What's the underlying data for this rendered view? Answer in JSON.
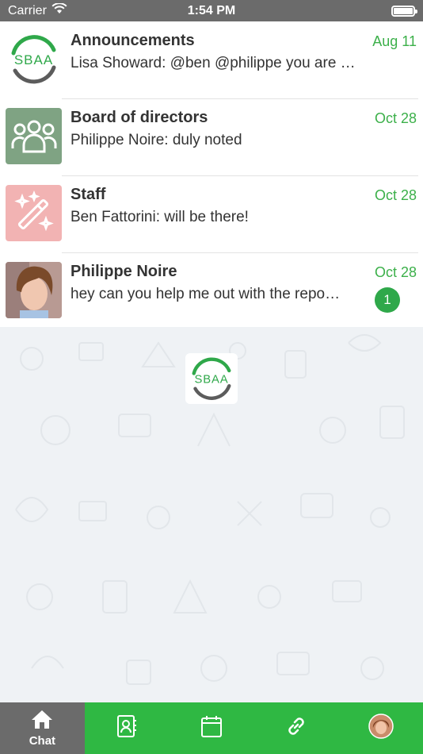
{
  "status_bar": {
    "carrier": "Carrier",
    "time": "1:54 PM",
    "battery_level": 1.0
  },
  "chats": [
    {
      "name": "Announcements",
      "preview": "Lisa Showard: @ben @philippe you are …",
      "date": "Aug 11",
      "avatar": "sbaa-logo",
      "unread": ""
    },
    {
      "name": "Board of directors",
      "preview": "Philippe Noire: duly noted",
      "date": "Oct 28",
      "avatar": "group-icon",
      "unread": ""
    },
    {
      "name": "Staff",
      "preview": "Ben Fattorini: will be there!",
      "date": "Oct 28",
      "avatar": "magic-wand-icon",
      "unread": ""
    },
    {
      "name": "Philippe Noire",
      "preview": "hey can you help me out with the repo…",
      "date": "Oct 28",
      "avatar": "user-photo",
      "unread": "1"
    }
  ],
  "logo_text": "SBAA",
  "tabs": [
    {
      "label": "Chat",
      "icon": "home-icon",
      "active": true
    },
    {
      "label": "",
      "icon": "contacts-icon",
      "active": false
    },
    {
      "label": "",
      "icon": "calendar-icon",
      "active": false
    },
    {
      "label": "",
      "icon": "link-icon",
      "active": false
    },
    {
      "label": "",
      "icon": "profile-avatar",
      "active": false
    }
  ],
  "colors": {
    "accent": "#3cb04a",
    "tab_bar": "#2fb843",
    "tab_active": "#6b6b6b",
    "status_bar": "#6b6b6b",
    "group_avatar_bg": "#7fa383",
    "staff_avatar_bg": "#f2b3b3"
  }
}
